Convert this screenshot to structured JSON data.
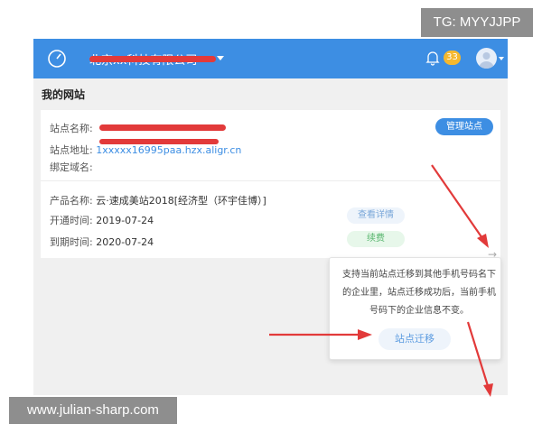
{
  "watermarks": {
    "telegram": "TG: MYYJJPP",
    "site": "www.julian-sharp.com"
  },
  "header": {
    "company_name": "北京xx科技有限公司",
    "notification_count": "33",
    "icons": [
      "dashboard-icon",
      "bell-icon",
      "avatar"
    ]
  },
  "page_title": "我的网站",
  "site_card": {
    "site_name_label": "站点名称:",
    "site_address_label": "站点地址:",
    "site_address_value": "1xxxxx16995paa.hzx.aligr.cn",
    "bind_domain_label": "绑定域名:",
    "manage_button": "管理站点",
    "product_label": "产品名称:",
    "product_value": "云·速成美站2018[经济型（环宇佳博）]",
    "open_label": "开通时间:",
    "open_value": "2019-07-24",
    "expire_label": "到期时间:",
    "expire_value": "2020-07-24",
    "detail_button": "查看详情",
    "renew_button": "续费"
  },
  "migrate_popover": {
    "description": "支持当前站点迁移到其他手机号码名下的企业里，站点迁移成功后，当前手机号码下的企业信息不变。",
    "button": "站点迁移"
  },
  "colors": {
    "topbar": "#3d8ee3",
    "badge": "#f5b82e",
    "annotation": "#e23a3a"
  }
}
